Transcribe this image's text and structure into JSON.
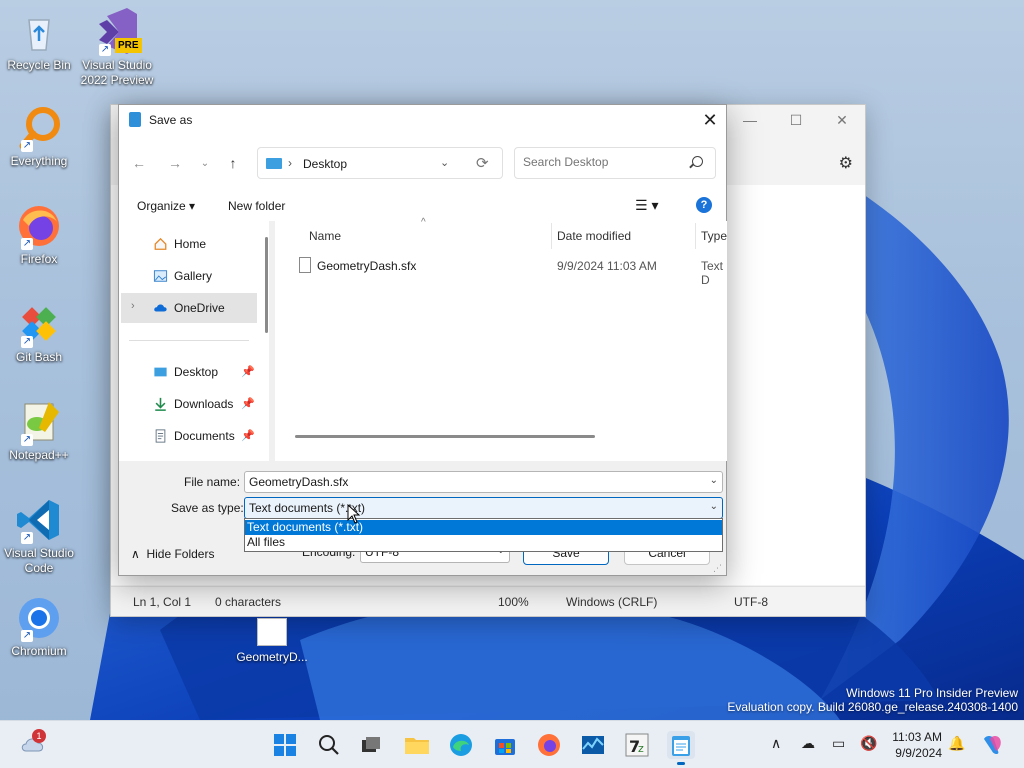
{
  "desktop": {
    "icons": [
      {
        "label": "Recycle Bin",
        "icon": "recycle-bin-icon"
      },
      {
        "label": "Visual Studio 2022 Preview",
        "icon": "visual-studio-preview-icon",
        "badge": "PRE"
      },
      {
        "label": "Everything",
        "icon": "everything-search-icon"
      },
      {
        "label": "Firefox",
        "icon": "firefox-icon"
      },
      {
        "label": "Git Bash",
        "icon": "git-bash-icon"
      },
      {
        "label": "Notepad++",
        "icon": "notepadpp-icon"
      },
      {
        "label": "Visual Studio Code",
        "icon": "vscode-icon"
      },
      {
        "label": "Chromium",
        "icon": "chromium-icon"
      }
    ],
    "file_label": "GeometryD...",
    "watermark": {
      "line1": "Windows 11 Pro Insider Preview",
      "line2": "Evaluation copy. Build 26080.ge_release.240308-1400"
    }
  },
  "notepad": {
    "status": {
      "position": "Ln 1, Col 1",
      "chars": "0 characters",
      "zoom": "100%",
      "line_ending": "Windows (CRLF)",
      "encoding": "UTF-8"
    }
  },
  "dialog": {
    "title": "Save as",
    "address": {
      "path": "Desktop"
    },
    "search": {
      "placeholder": "Search Desktop"
    },
    "toolbar": {
      "organize": "Organize",
      "new_folder": "New folder",
      "help": "?"
    },
    "nav": [
      {
        "label": "Home",
        "pinned": false
      },
      {
        "label": "Gallery",
        "pinned": false
      },
      {
        "label": "OneDrive",
        "pinned": false,
        "selected": true
      },
      {
        "label": "Desktop",
        "pinned": true
      },
      {
        "label": "Downloads",
        "pinned": true
      },
      {
        "label": "Documents",
        "pinned": true
      }
    ],
    "columns": {
      "name": "Name",
      "date": "Date modified",
      "type": "Type"
    },
    "files": [
      {
        "name": "GeometryDash.sfx",
        "date": "9/9/2024 11:03 AM",
        "type": "Text D"
      }
    ],
    "file_name_label": "File name:",
    "file_name_value": "GeometryDash.sfx",
    "save_type_label": "Save as type:",
    "save_type_value": "Text documents (*.txt)",
    "save_type_options": [
      "Text documents (*.txt)",
      "All files"
    ],
    "encoding_label": "Encoding:",
    "encoding_value": "UTF-8",
    "hide_folders": "Hide Folders",
    "save_button": "Save",
    "cancel_button": "Cancel"
  },
  "taskbar": {
    "notification_badge": "1",
    "clock_time": "11:03 AM",
    "clock_date": "9/9/2024"
  },
  "colors": {
    "accent": "#0078d7",
    "taskbar": "#e9eef5"
  }
}
